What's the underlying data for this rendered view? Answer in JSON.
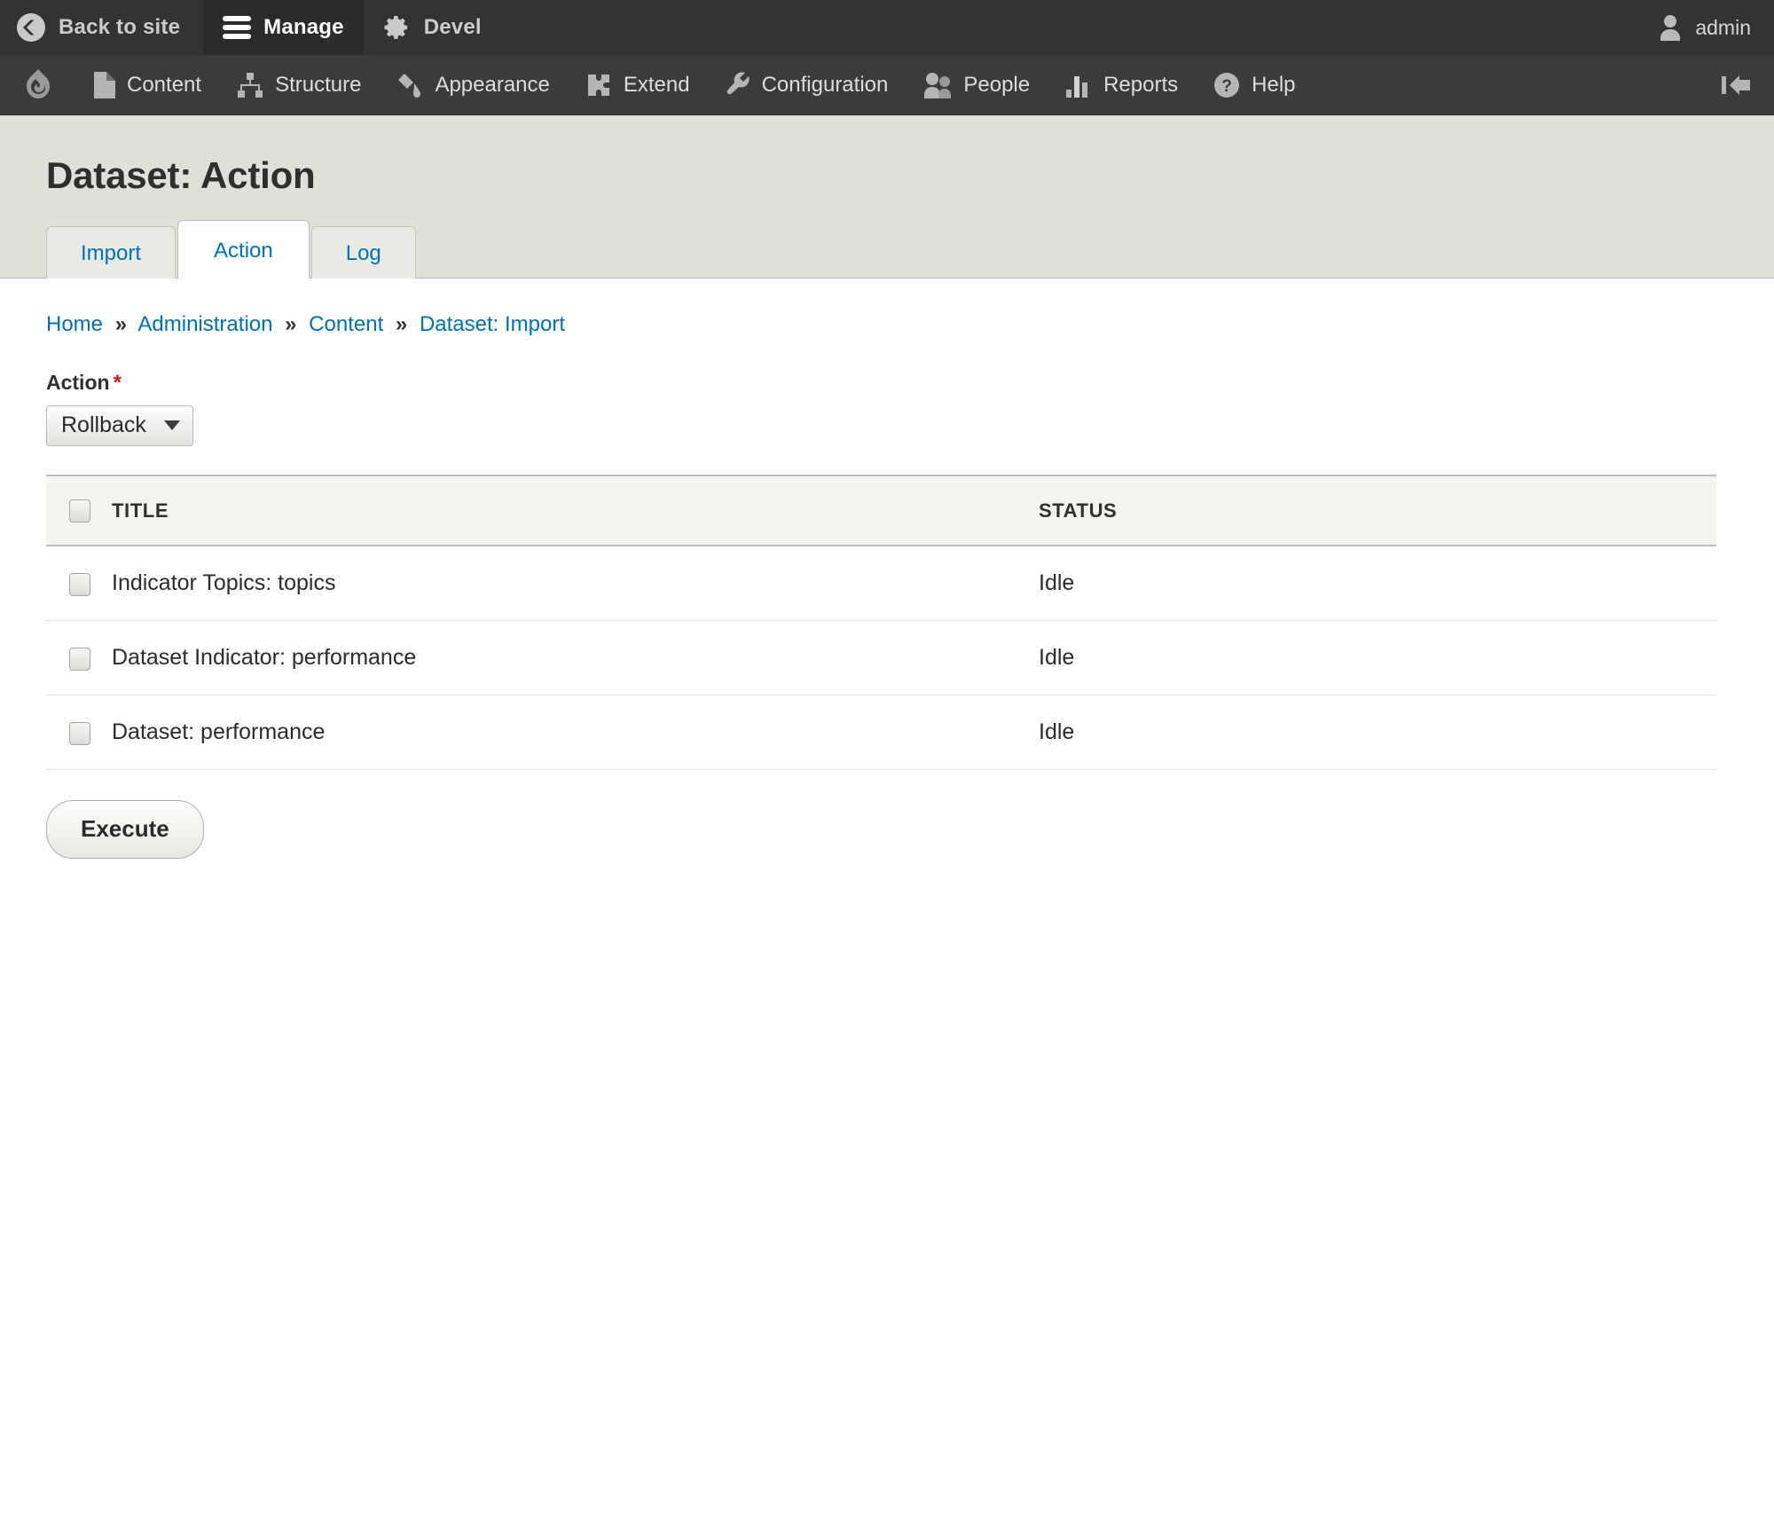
{
  "toolbar": {
    "back_to_site": "Back to site",
    "manage": "Manage",
    "devel": "Devel",
    "user": "admin",
    "menu": [
      {
        "label": "Content",
        "icon": "content-icon"
      },
      {
        "label": "Structure",
        "icon": "structure-icon"
      },
      {
        "label": "Appearance",
        "icon": "appearance-icon"
      },
      {
        "label": "Extend",
        "icon": "extend-icon"
      },
      {
        "label": "Configuration",
        "icon": "configuration-icon"
      },
      {
        "label": "People",
        "icon": "people-icon"
      },
      {
        "label": "Reports",
        "icon": "reports-icon"
      },
      {
        "label": "Help",
        "icon": "help-icon"
      }
    ]
  },
  "page": {
    "title": "Dataset: Action"
  },
  "tabs": [
    {
      "label": "Import",
      "active": false
    },
    {
      "label": "Action",
      "active": true
    },
    {
      "label": "Log",
      "active": false
    }
  ],
  "breadcrumb": {
    "items": [
      "Home",
      "Administration",
      "Content",
      "Dataset: Import"
    ],
    "separator": "»"
  },
  "form": {
    "action_label": "Action",
    "required_marker": "*",
    "action_value": "Rollback",
    "action_options": [
      "Rollback"
    ],
    "execute_label": "Execute"
  },
  "table": {
    "headers": {
      "title": "TITLE",
      "status": "STATUS"
    },
    "select_all_checked": false,
    "rows": [
      {
        "checked": false,
        "title": "Indicator Topics: topics",
        "status": "Idle"
      },
      {
        "checked": false,
        "title": "Dataset Indicator: performance",
        "status": "Idle"
      },
      {
        "checked": false,
        "title": "Dataset: performance",
        "status": "Idle"
      }
    ]
  },
  "colors": {
    "toolbar_bg": "#333333",
    "toolbar_menu_bg": "#3b3b3b",
    "page_head_bg": "#e0e0d9",
    "link": "#0071b3",
    "required": "#d01b1b",
    "table_header_bg": "#f4f4ef"
  }
}
